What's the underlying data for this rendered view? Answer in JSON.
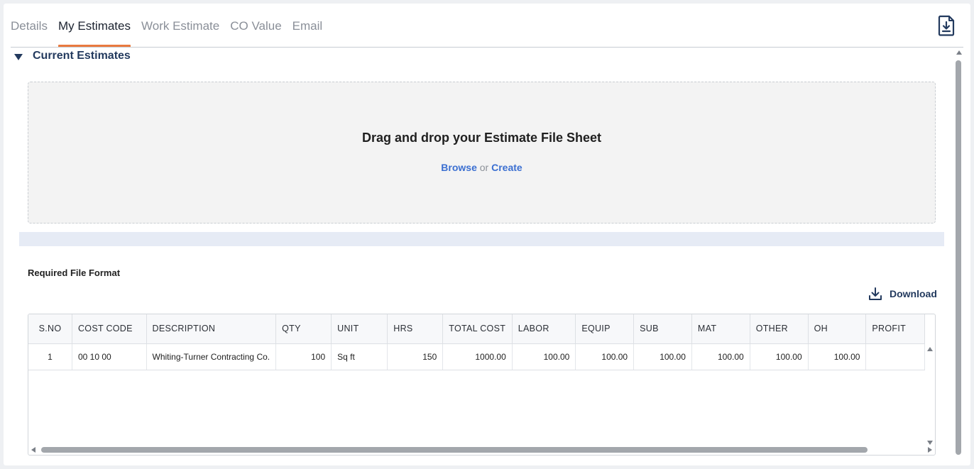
{
  "tabs": [
    {
      "label": "Details"
    },
    {
      "label": "My Estimates"
    },
    {
      "label": "Work Estimate"
    },
    {
      "label": "CO Value"
    },
    {
      "label": "Email"
    }
  ],
  "active_tab": "My Estimates",
  "section": {
    "title": "Current Estimates"
  },
  "dropzone": {
    "title": "Drag and drop your Estimate File Sheet",
    "browse_label": "Browse",
    "or_label": "or",
    "create_label": "Create"
  },
  "file_format": {
    "title": "Required File Format",
    "download_label": "Download",
    "columns": [
      "S.NO",
      "COST CODE",
      "DESCRIPTION",
      "QTY",
      "UNIT",
      "HRS",
      "TOTAL COST",
      "LABOR",
      "EQUIP",
      "SUB",
      "MAT",
      "OTHER",
      "OH",
      "PROFIT"
    ],
    "rows": [
      [
        "1",
        "00 10 00",
        "Whiting-Turner Contracting Co.",
        "100",
        "Sq ft",
        "150",
        "1000.00",
        "100.00",
        "100.00",
        "100.00",
        "100.00",
        "100.00",
        "100.00",
        ""
      ]
    ]
  },
  "colors": {
    "accent": "#e97a3f",
    "link": "#3b6fd1",
    "heading": "#233a5e"
  }
}
